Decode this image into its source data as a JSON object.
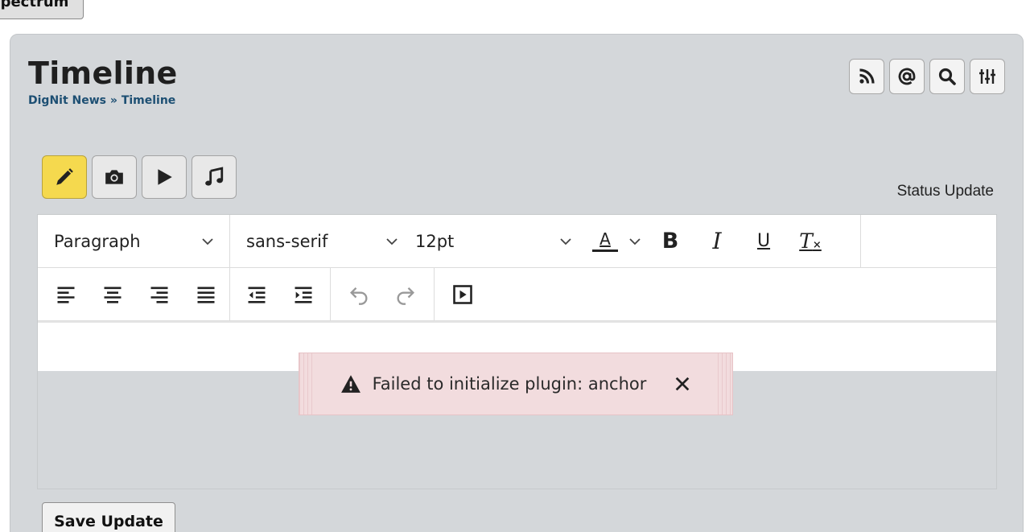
{
  "top_button": {
    "label": "pectrum"
  },
  "header": {
    "title": "Timeline",
    "breadcrumb": {
      "root": "DigNit News",
      "separator": "»",
      "current": "Timeline"
    },
    "icons": [
      "rss-icon",
      "at-icon",
      "search-icon",
      "sliders-icon"
    ]
  },
  "post_types": {
    "items": [
      {
        "icon": "pencil-icon",
        "active": true
      },
      {
        "icon": "camera-icon",
        "active": false
      },
      {
        "icon": "play-icon",
        "active": false
      },
      {
        "icon": "music-icon",
        "active": false
      }
    ],
    "label": "Status Update"
  },
  "editor": {
    "block_format": "Paragraph",
    "font_family": "sans-serif",
    "font_size": "12pt",
    "text_color_letter": "A",
    "bold": "B",
    "italic": "I",
    "underline": "U",
    "clear_format": "T"
  },
  "notification": {
    "message": "Failed to initialize plugin: anchor",
    "close": "×"
  },
  "save_button": {
    "label": "Save Update"
  },
  "colors": {
    "panel": "#d4d7da",
    "active_type": "#f5d94e",
    "notification_bg": "#f2dcde",
    "breadcrumb": "#1d4f73"
  }
}
